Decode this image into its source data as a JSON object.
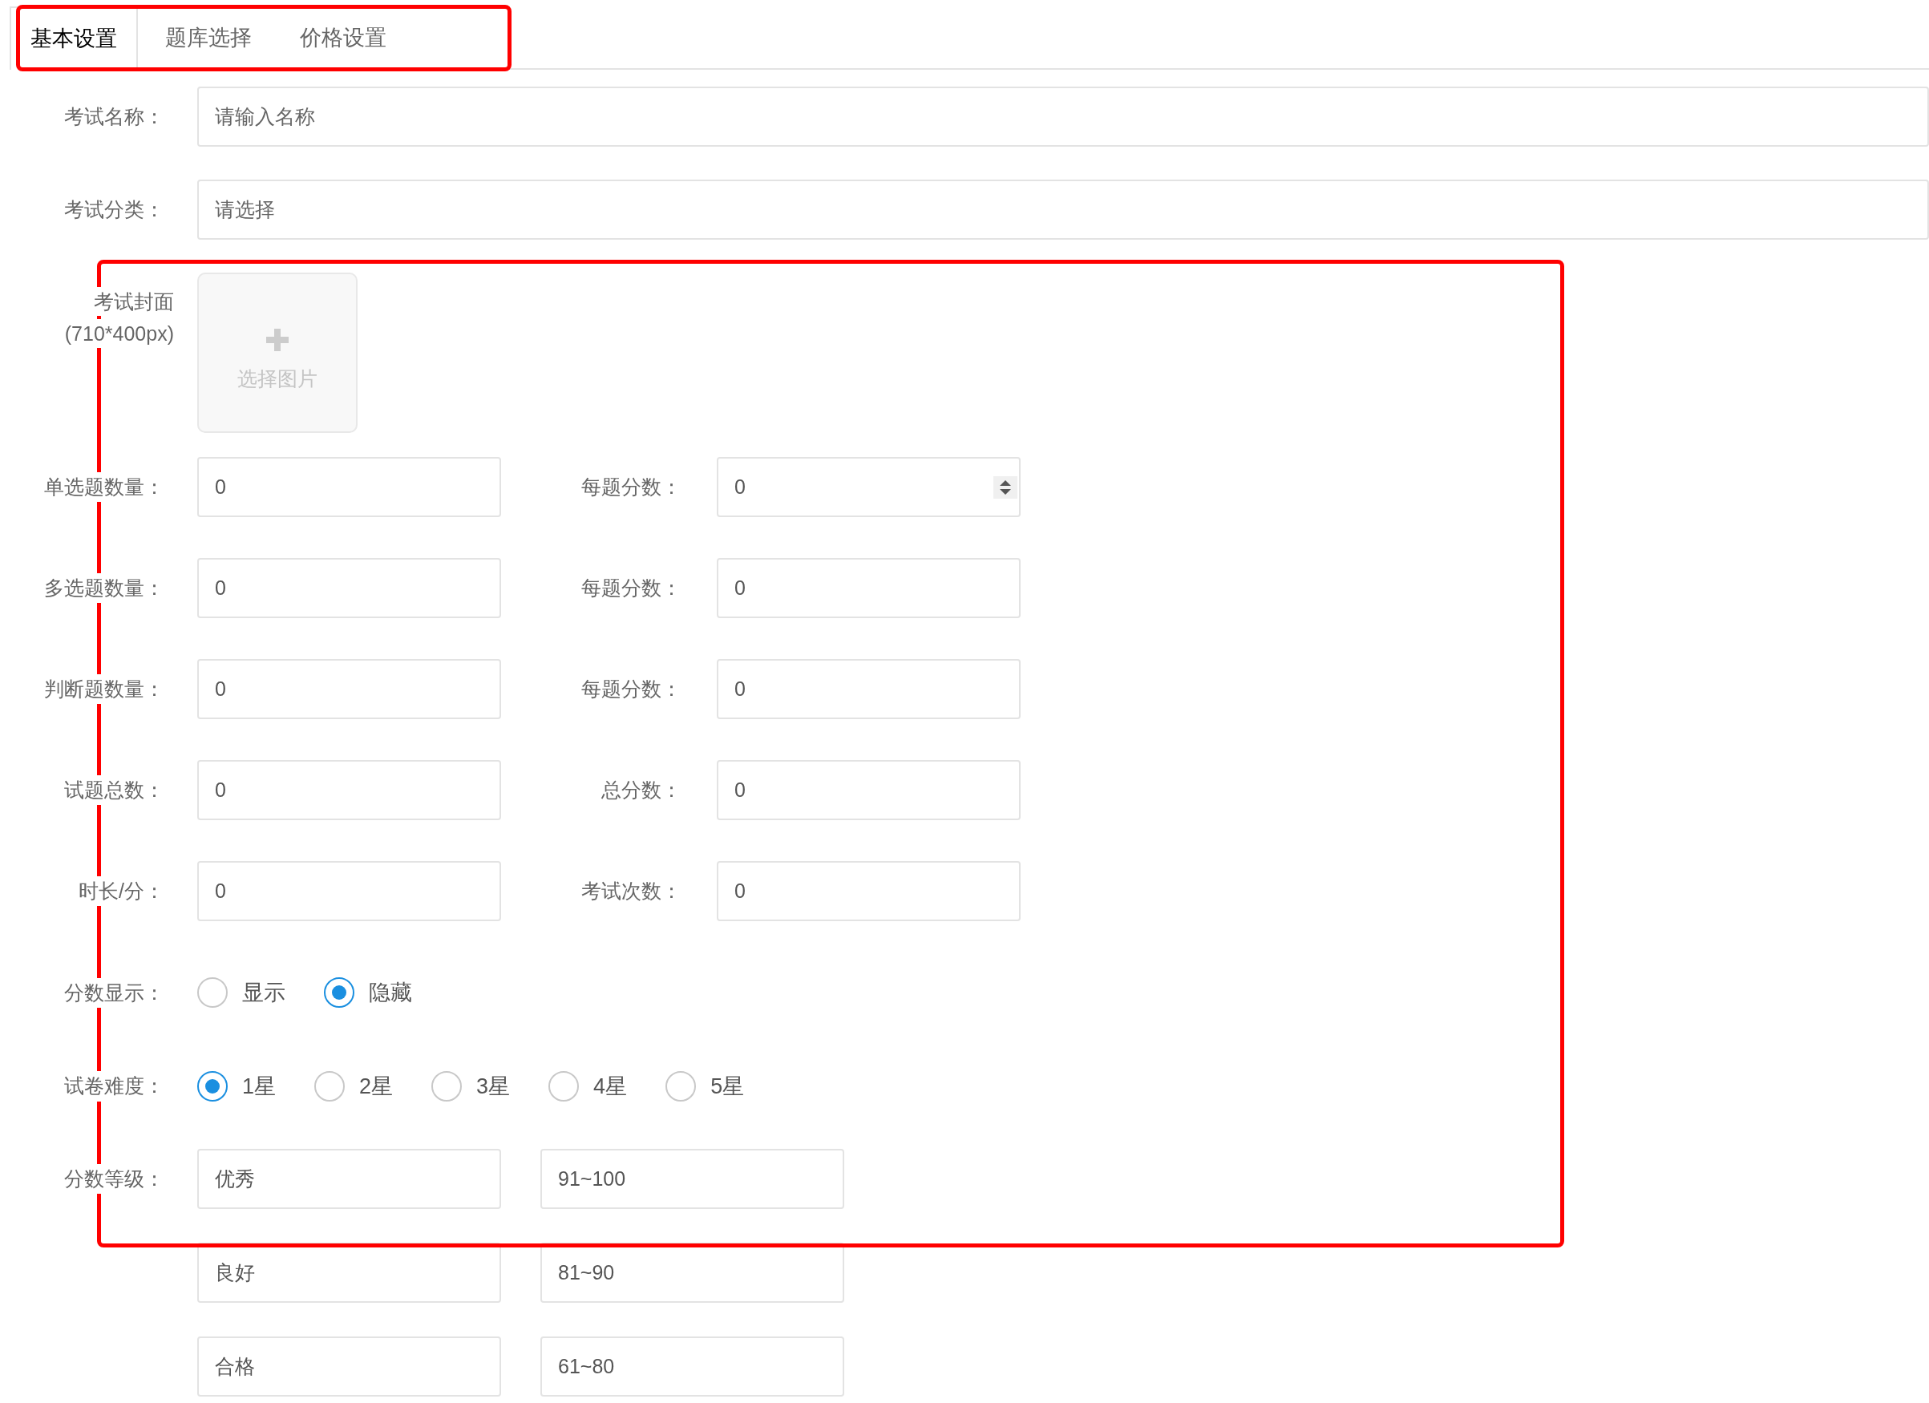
{
  "tabs": [
    {
      "label": "基本设置",
      "selected": true
    },
    {
      "label": "题库选择",
      "selected": false
    },
    {
      "label": "价格设置",
      "selected": false
    }
  ],
  "name_field": {
    "label": "考试名称：",
    "placeholder": "请输入名称"
  },
  "category_field": {
    "label": "考试分类：",
    "placeholder": "请选择"
  },
  "cover": {
    "label_lines": [
      "考试封面",
      "(710*400px)"
    ],
    "button": "选择图片"
  },
  "pair_rows": [
    {
      "left": {
        "label": "单选题数量：",
        "value": "0"
      },
      "right": {
        "label": "每题分数：",
        "value": "0",
        "spinner": true
      }
    },
    {
      "left": {
        "label": "多选题数量：",
        "value": "0"
      },
      "right": {
        "label": "每题分数：",
        "value": "0",
        "spinner": false
      }
    },
    {
      "left": {
        "label": "判断题数量：",
        "value": "0"
      },
      "right": {
        "label": "每题分数：",
        "value": "0",
        "spinner": false
      }
    },
    {
      "left": {
        "label": "试题总数：",
        "value": "0"
      },
      "right": {
        "label": "总分数：",
        "value": "0",
        "spinner": false
      }
    },
    {
      "left": {
        "label": "时长/分：",
        "value": "0"
      },
      "right": {
        "label": "考试次数：",
        "value": "0",
        "spinner": false
      }
    }
  ],
  "radio_groups": [
    {
      "label": "分数显示：",
      "options": [
        {
          "label": "显示",
          "selected": false
        },
        {
          "label": "隐藏",
          "selected": true
        }
      ]
    },
    {
      "label": "试卷难度：",
      "options": [
        {
          "label": "1星",
          "selected": true
        },
        {
          "label": "2星",
          "selected": false
        },
        {
          "label": "3星",
          "selected": false
        },
        {
          "label": "4星",
          "selected": false
        },
        {
          "label": "5星",
          "selected": false
        }
      ]
    }
  ],
  "grades": {
    "label": "分数等级：",
    "rows": [
      {
        "name": "优秀",
        "range": "91~100"
      },
      {
        "name": "良好",
        "range": "81~90"
      },
      {
        "name": "合格",
        "range": "61~80"
      }
    ]
  }
}
